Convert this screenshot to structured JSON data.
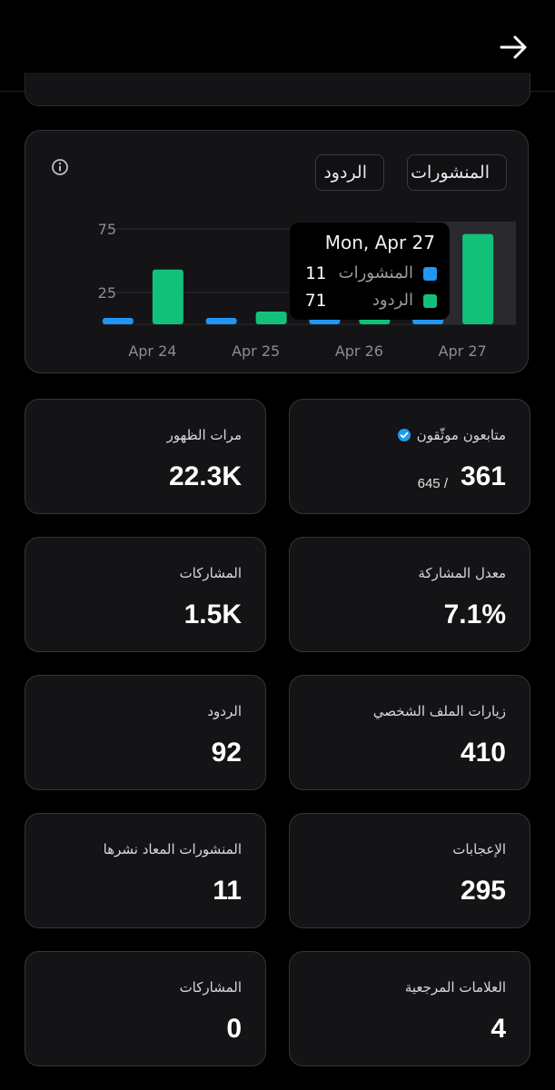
{
  "colors": {
    "posts": "#2196f3",
    "replies": "#12c179",
    "background": "#000000",
    "card": "#141417"
  },
  "header": {
    "back_icon": "arrow-right-icon"
  },
  "chart_card": {
    "info_icon": "info-icon",
    "legend": {
      "posts": "المنشورات",
      "replies": "الردود"
    },
    "tooltip": {
      "title": "Mon, Apr 27",
      "posts_label": "المنشورات",
      "posts_value": "11",
      "replies_label": "الردود",
      "replies_value": "71"
    }
  },
  "chart_data": {
    "type": "bar",
    "categories": [
      "Apr 24",
      "Apr 25",
      "Apr 26",
      "Apr 27"
    ],
    "series": [
      {
        "name": "المنشورات",
        "values": [
          5,
          5,
          5,
          11
        ]
      },
      {
        "name": "الردود",
        "values": [
          43,
          10,
          5,
          71
        ]
      }
    ],
    "yticks": [
      25,
      75
    ],
    "ylim": [
      0,
      75
    ],
    "grid": true,
    "highlighted_category": "Apr 27"
  },
  "stats": [
    {
      "label": "متابعون موثّقون",
      "value": "361",
      "sub": "645 /",
      "verified_icon": "verified-badge-icon"
    },
    {
      "label": "مرات الظهور",
      "value": "22.3K"
    },
    {
      "label": "معدل المشاركة",
      "value": "7.1%"
    },
    {
      "label": "المشاركات",
      "value": "1.5K"
    },
    {
      "label": "زيارات الملف الشخصي",
      "value": "410"
    },
    {
      "label": "الردود",
      "value": "92"
    },
    {
      "label": "الإعجابات",
      "value": "295"
    },
    {
      "label": "المنشورات المعاد نشرها",
      "value": "11"
    },
    {
      "label": "العلامات المرجعية",
      "value": "4"
    },
    {
      "label": "المشاركات",
      "value": "0"
    }
  ]
}
